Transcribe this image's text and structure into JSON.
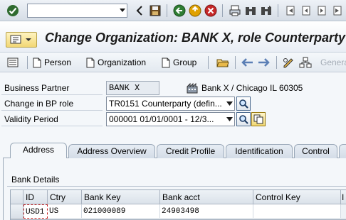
{
  "toolbar": {
    "command_field_value": "",
    "icons": [
      "enter-icon",
      "save-icon",
      "back-icon",
      "exit-icon",
      "cancel-icon",
      "print-icon",
      "find-icon",
      "find-next-icon",
      "first-page-icon",
      "prev-page-icon",
      "next-page-icon",
      "last-page-icon"
    ]
  },
  "title": {
    "text": "Change Organization: BANK X, role Counterparty"
  },
  "app_toolbar": {
    "person_label": "Person",
    "organization_label": "Organization",
    "group_label": "Group",
    "general_label": "Genera"
  },
  "form": {
    "business_partner_label": "Business Partner",
    "business_partner_value": "BANK X",
    "business_partner_desc": "Bank X / Chicago IL 60305",
    "role_label": "Change in BP role",
    "role_value": "TR0151 Counterparty (defin...",
    "validity_label": "Validity Period",
    "validity_value": "000001 01/01/0001 - 12/3..."
  },
  "tabs": [
    {
      "label": "Address"
    },
    {
      "label": "Address Overview"
    },
    {
      "label": "Credit Profile"
    },
    {
      "label": "Identification"
    },
    {
      "label": "Control"
    }
  ],
  "bank_details": {
    "group_title": "Bank Details",
    "columns": [
      "ID",
      "Ctry",
      "Bank Key",
      "Bank acct",
      "Control Key",
      "I"
    ],
    "rows": [
      {
        "id": "USD1",
        "ctry": "US",
        "bank_key": "021000089",
        "bank_acct": "24903498",
        "control_key": ""
      }
    ]
  },
  "colors": {
    "toolbar_bg": "#dfe5ec",
    "title_menu_button": "#f2d774",
    "focus_outline": "#c81e1e"
  }
}
